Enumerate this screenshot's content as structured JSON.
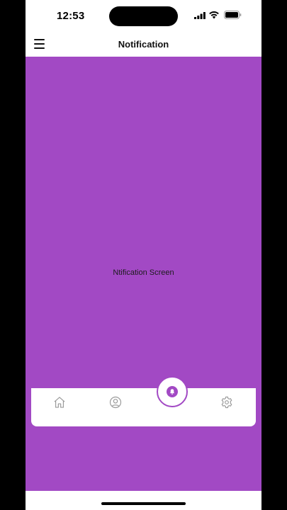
{
  "status_bar": {
    "time": "12:53"
  },
  "header": {
    "title": "Notification"
  },
  "content": {
    "text": "Ntification Screen",
    "background": "#a249c4"
  },
  "tabs": [
    {
      "name": "home",
      "icon": "home-icon",
      "active": false
    },
    {
      "name": "profile",
      "icon": "user-circle-icon",
      "active": false
    },
    {
      "name": "notification",
      "icon": "bell-icon",
      "active": true
    },
    {
      "name": "settings",
      "icon": "gear-icon",
      "active": false
    }
  ],
  "colors": {
    "accent": "#a249c4",
    "inactive_icon": "#9a9a9a"
  }
}
